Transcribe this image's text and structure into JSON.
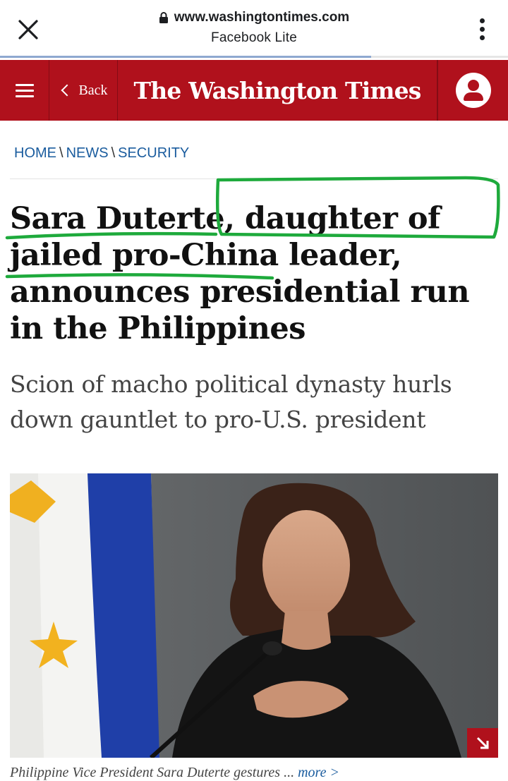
{
  "browser": {
    "url": "www.washingtontimes.com",
    "app_name": "Facebook Lite",
    "close_icon": "close-icon",
    "lock_icon": "lock-icon",
    "menu_icon": "kebab-menu-icon",
    "load_progress": 0.73
  },
  "site_header": {
    "back_label": "Back",
    "logo_text": "The Washington Times",
    "brand_color": "#b0111c",
    "menu_icon": "hamburger-icon",
    "account_icon": "account-icon"
  },
  "breadcrumb": {
    "items": [
      "HOME",
      "NEWS",
      "SECURITY"
    ],
    "separator": "\\"
  },
  "article": {
    "headline_parts": [
      "Sara Duterte, ",
      "daughter of jailed",
      " ",
      "pro-China leader",
      ", announces presidential run in the Philippines"
    ],
    "subheadline": "Scion of macho political dynasty hurls down gauntlet to pro-U.S. president",
    "photo_alt": "Philippine Vice President Sara Duterte gestures",
    "caption": "Philippine Vice President Sara Duterte gestures ...",
    "caption_more": "more >",
    "annotation_color": "#1eaa3c"
  }
}
